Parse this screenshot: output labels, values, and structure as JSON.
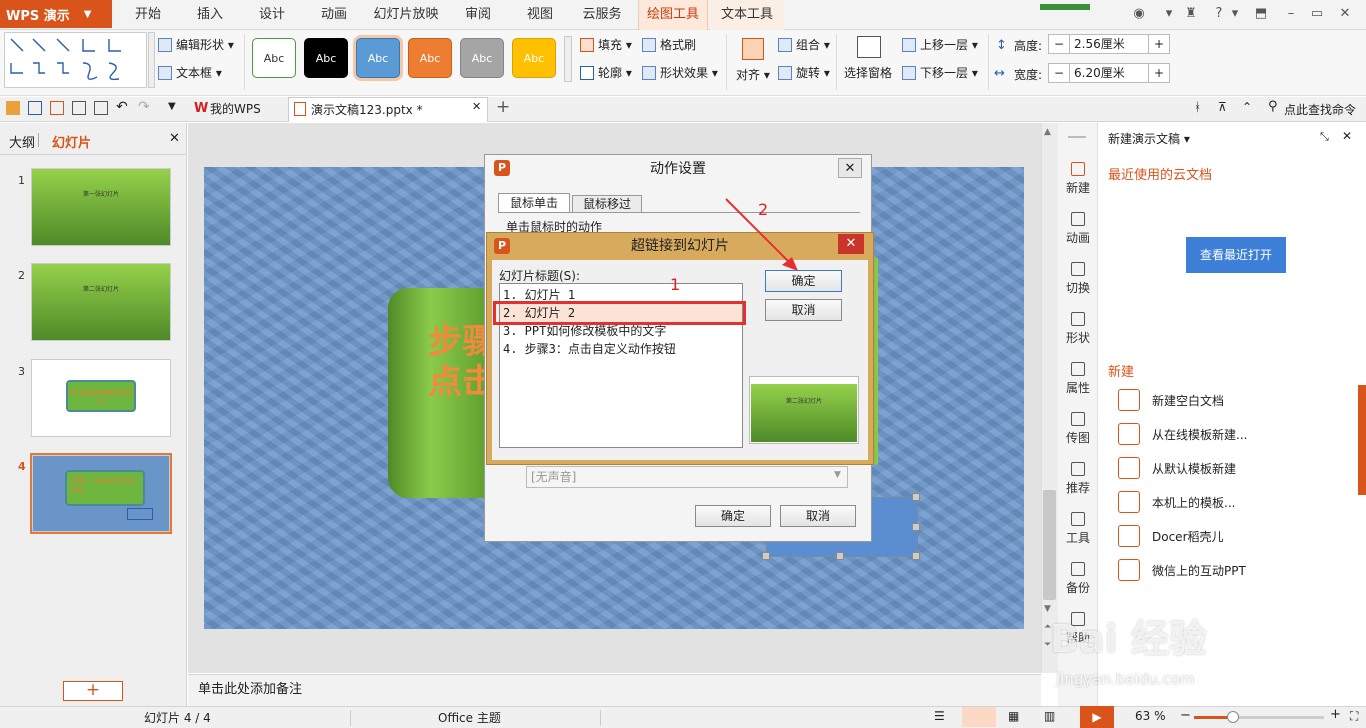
{
  "app": {
    "logo": "WPS 演示"
  },
  "menu": {
    "items": [
      "开始",
      "插入",
      "设计",
      "动画",
      "幻灯片放映",
      "审阅",
      "视图",
      "云服务",
      "绘图工具",
      "文本工具"
    ]
  },
  "ribbon": {
    "edit_shape": "编辑形状",
    "textbox": "文本框",
    "fill": "填充",
    "format_brush": "格式刷",
    "outline": "轮廓",
    "shape_effect": "形状效果",
    "align": "对齐",
    "group": "组合",
    "rotate": "旋转",
    "select_pane": "选择窗格",
    "bring_forward": "上移一层",
    "send_backward": "下移一层",
    "height_label": "高度:",
    "height_value": "2.56厘米",
    "width_label": "宽度:",
    "width_value": "6.20厘米",
    "swatches": [
      {
        "label": "Abc",
        "bg": "#ffffff",
        "fg": "#333333",
        "border": "#4f9a3a"
      },
      {
        "label": "Abc",
        "bg": "#000000",
        "fg": "#ffffff",
        "border": "#000000"
      },
      {
        "label": "Abc",
        "bg": "#5b9bd5",
        "fg": "#ffffff",
        "border": "#3a78b3"
      },
      {
        "label": "Abc",
        "bg": "#ed7d31",
        "fg": "#ffffff",
        "border": "#c8601a"
      },
      {
        "label": "Abc",
        "bg": "#a5a5a5",
        "fg": "#ffffff",
        "border": "#858585"
      },
      {
        "label": "Abc",
        "bg": "#ffc000",
        "fg": "#ffffff",
        "border": "#d9a000"
      }
    ]
  },
  "tabs": {
    "wps": "我的WPS",
    "doc": "演示文稿123.pptx *",
    "search": "点此查找命令"
  },
  "leftpanel": {
    "outline": "大纲",
    "slides": "幻灯片",
    "thumbs": [
      {
        "num": "1",
        "text": "第一张幻灯片"
      },
      {
        "num": "2",
        "text": "第二张幻灯片"
      },
      {
        "num": "3",
        "text": "PPT如何修改模板中的文字"
      },
      {
        "num": "4",
        "text": "步骤3：点击自定义动作按钮"
      }
    ]
  },
  "slide": {
    "title_line1": "步骤",
    "title_line2": "点击"
  },
  "notes": "单击此处添加备注",
  "action_dialog": {
    "title": "动作设置",
    "tab_click": "鼠标单击",
    "tab_hover": "鼠标移过",
    "section": "单击鼠标时的动作",
    "sound": "[无声音]",
    "ok": "确定",
    "cancel": "取消"
  },
  "link_dialog": {
    "title": "超链接到幻灯片",
    "list_label": "幻灯片标题(S):",
    "items": [
      "1. 幻灯片 1",
      "2. 幻灯片 2",
      "3. PPT如何修改模板中的文字",
      "4. 步骤3：点击自定义动作按钮"
    ],
    "ok": "确定",
    "cancel": "取消",
    "preview_text": "第二张幻灯片"
  },
  "annotations": {
    "one": "1",
    "two": "2"
  },
  "right_icons": [
    "新建",
    "动画",
    "切换",
    "形状",
    "属性",
    "传图",
    "推荐",
    "工具",
    "备份",
    "帮助"
  ],
  "rightpanel": {
    "title": "新建演示文稿",
    "cloud_title": "最近使用的云文档",
    "view_recent": "查看最近打开",
    "new_title": "新建",
    "items": [
      "新建空白文档",
      "从在线模板新建...",
      "从默认模板新建",
      "本机上的模板...",
      "Docer稻壳儿",
      "微信上的互动PPT"
    ]
  },
  "status": {
    "slide": "幻灯片 4 / 4",
    "theme": "Office 主题",
    "zoom": "63 %"
  },
  "watermark": {
    "brand": "Bai 经验",
    "url": "jingyan.baidu.com"
  }
}
